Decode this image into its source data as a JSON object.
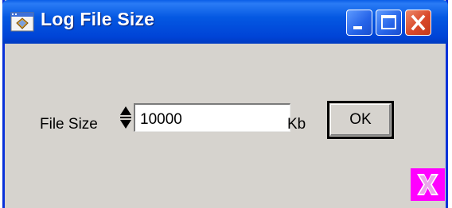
{
  "window": {
    "title": "Log File Size",
    "icons": {
      "app": "app-icon",
      "minimize": "minimize-icon",
      "maximize": "maximize-icon",
      "close": "close-icon"
    }
  },
  "form": {
    "label": "File Size",
    "value": "10000",
    "unit": "Kb",
    "ok_label": "OK"
  },
  "corner_button": {
    "icon": "exit-icon",
    "color": "#ff00ff"
  },
  "colors": {
    "title_bar": "#0054e3",
    "dialog_bg": "#d6d3ce",
    "close_button": "#d9482a"
  }
}
